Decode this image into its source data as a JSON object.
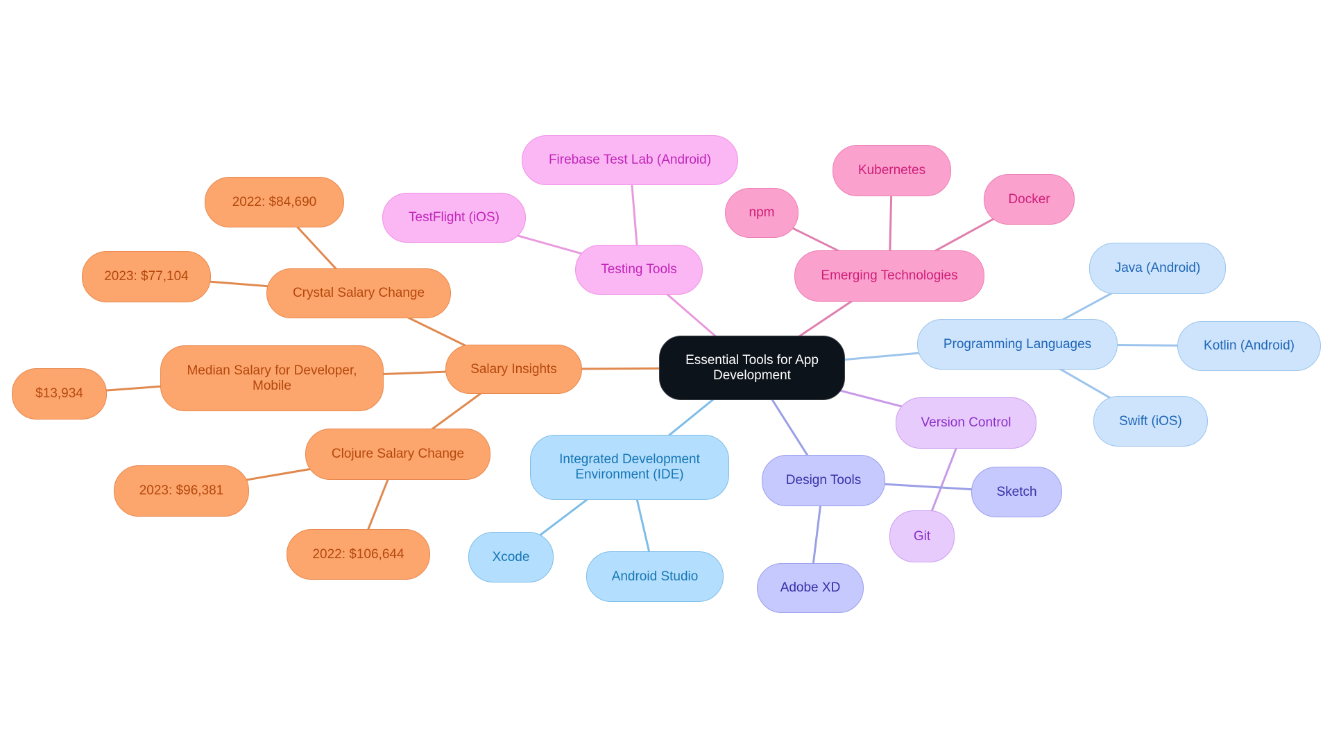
{
  "title": "Essential Tools for App Development",
  "colors": {
    "salary": "#e0894f",
    "testing": "#e99ade",
    "emerging": "#e07fae",
    "proglang": "#9cc4ec",
    "version": "#c89ae8",
    "design": "#9a9fe6",
    "ide": "#7ebde8"
  },
  "nodes": {
    "root": "Essential Tools for App Development",
    "salary_insights": "Salary Insights",
    "crystal": "Crystal Salary Change",
    "crystal_2022": "2022: $84,690",
    "crystal_2023": "2023: $77,104",
    "median": "Median Salary for Developer, Mobile",
    "median_value": "$13,934",
    "clojure": "Clojure Salary Change",
    "clojure_2023": "2023: $96,381",
    "clojure_2022": "2022: $106,644",
    "testing": "Testing Tools",
    "firebase": "Firebase Test Lab (Android)",
    "testflight": "TestFlight (iOS)",
    "emerging": "Emerging Technologies",
    "npm": "npm",
    "kubernetes": "Kubernetes",
    "docker": "Docker",
    "proglang": "Programming Languages",
    "java": "Java (Android)",
    "kotlin": "Kotlin (Android)",
    "swift": "Swift (iOS)",
    "version": "Version Control",
    "git": "Git",
    "design": "Design Tools",
    "sketch": "Sketch",
    "adobexd": "Adobe XD",
    "ide": "Integrated Development Environment (IDE)",
    "xcode": "Xcode",
    "androidstudio": "Android Studio"
  },
  "edges": [
    [
      "root",
      "salary_insights",
      "salary"
    ],
    [
      "salary_insights",
      "crystal",
      "salary"
    ],
    [
      "crystal",
      "crystal_2022",
      "salary"
    ],
    [
      "crystal",
      "crystal_2023",
      "salary"
    ],
    [
      "salary_insights",
      "median",
      "salary"
    ],
    [
      "median",
      "median_value",
      "salary"
    ],
    [
      "salary_insights",
      "clojure",
      "salary"
    ],
    [
      "clojure",
      "clojure_2023",
      "salary"
    ],
    [
      "clojure",
      "clojure_2022",
      "salary"
    ],
    [
      "root",
      "testing",
      "testing"
    ],
    [
      "testing",
      "firebase",
      "testing"
    ],
    [
      "testing",
      "testflight",
      "testing"
    ],
    [
      "root",
      "emerging",
      "emerging"
    ],
    [
      "emerging",
      "npm",
      "emerging"
    ],
    [
      "emerging",
      "kubernetes",
      "emerging"
    ],
    [
      "emerging",
      "docker",
      "emerging"
    ],
    [
      "root",
      "proglang",
      "proglang"
    ],
    [
      "proglang",
      "java",
      "proglang"
    ],
    [
      "proglang",
      "kotlin",
      "proglang"
    ],
    [
      "proglang",
      "swift",
      "proglang"
    ],
    [
      "root",
      "version",
      "version"
    ],
    [
      "version",
      "git",
      "version"
    ],
    [
      "root",
      "design",
      "design"
    ],
    [
      "design",
      "sketch",
      "design"
    ],
    [
      "design",
      "adobexd",
      "design"
    ],
    [
      "root",
      "ide",
      "ide"
    ],
    [
      "ide",
      "xcode",
      "ide"
    ],
    [
      "ide",
      "androidstudio",
      "ide"
    ]
  ]
}
